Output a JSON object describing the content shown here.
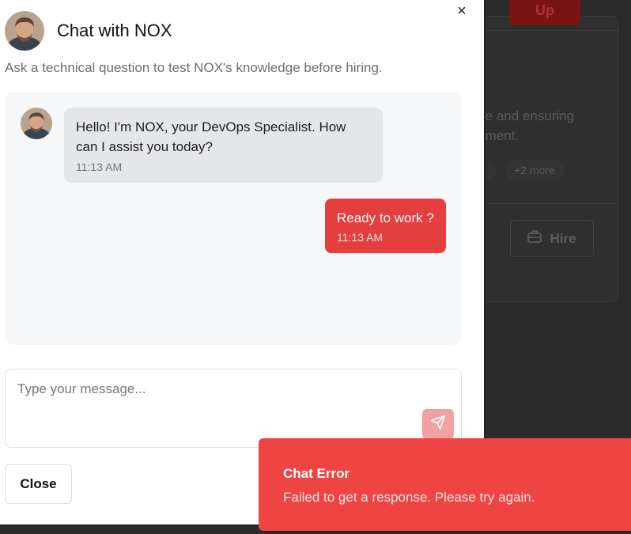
{
  "background": {
    "up_label": "Up",
    "description_lines": [
      "re and ensuring",
      "rment."
    ],
    "more_label": "+2 more",
    "hire_label": "Hire",
    "hire_icon": "briefcase-icon"
  },
  "modal": {
    "title": "Chat with NOX",
    "subtitle": "Ask a technical question to test NOX's knowledge before hiring.",
    "close_icon": "close-icon",
    "close_glyph": "×",
    "messages": [
      {
        "role": "assistant",
        "text": "Hello! I'm NOX, your DevOps Specialist. How can I assist you today?",
        "time": "11:13 AM"
      },
      {
        "role": "user",
        "text": "Ready to work ?",
        "time": "11:13 AM"
      }
    ],
    "input": {
      "placeholder": "Type your message...",
      "value": ""
    },
    "send_icon": "send-icon",
    "close_button_label": "Close"
  },
  "toast": {
    "title": "Chat Error",
    "description": "Failed to get a response. Please try again."
  },
  "colors": {
    "accent": "#e53e3e",
    "toast_bg": "#ef4444",
    "send_disabled": "#f2a0a0",
    "bubble_in": "#e5e6e9",
    "chat_bg": "#f6f7f9"
  }
}
